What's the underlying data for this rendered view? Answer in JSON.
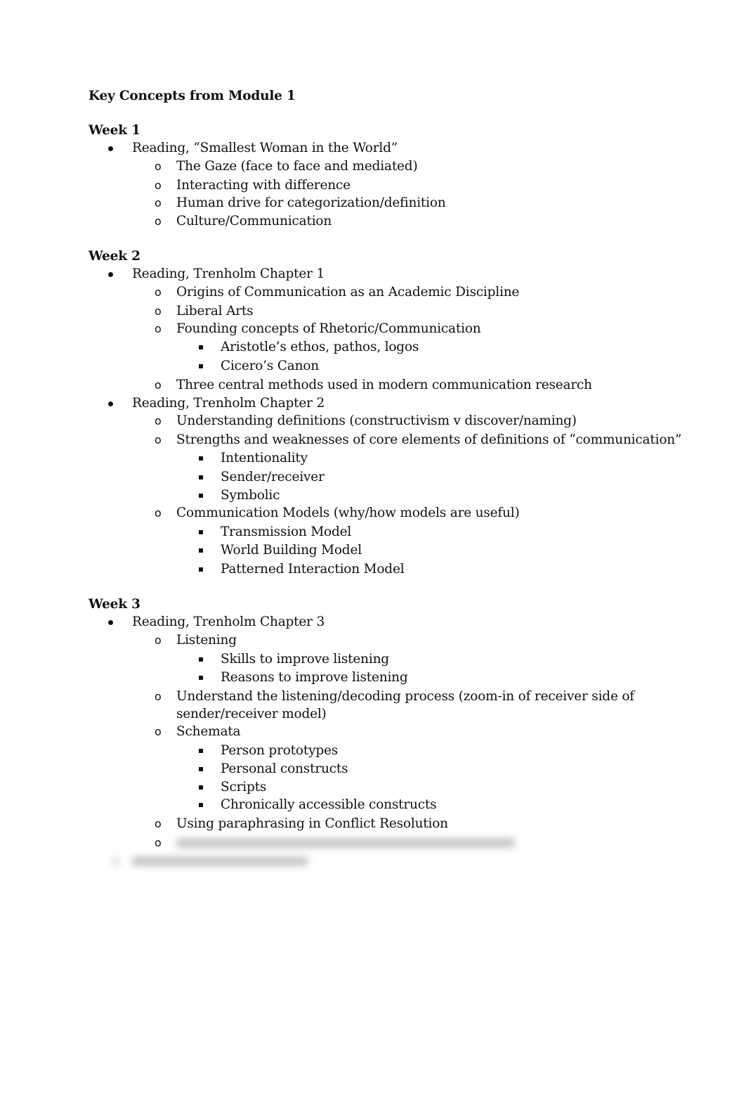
{
  "document": {
    "title": "Key Concepts from Module 1",
    "weeks": [
      {
        "heading": "Week 1",
        "readings": [
          {
            "label": "Reading, “Smallest Woman in the World”",
            "topics": [
              {
                "label": "The Gaze (face to face and mediated)"
              },
              {
                "label": "Interacting with difference"
              },
              {
                "label": "Human drive for categorization/definition"
              },
              {
                "label": "Culture/Communication"
              }
            ]
          }
        ]
      },
      {
        "heading": "Week 2",
        "readings": [
          {
            "label": "Reading, Trenholm Chapter 1",
            "topics": [
              {
                "label": "Origins of Communication as an Academic Discipline"
              },
              {
                "label": "Liberal Arts"
              },
              {
                "label": "Founding concepts of Rhetoric/Communication",
                "subtopics": [
                  "Aristotle’s ethos, pathos, logos",
                  "Cicero’s Canon"
                ]
              },
              {
                "label": "Three central methods used in modern communication research"
              }
            ]
          },
          {
            "label": "Reading, Trenholm Chapter 2",
            "topics": [
              {
                "label": "Understanding definitions (constructivism v discover/naming)"
              },
              {
                "label": "Strengths and weaknesses of core elements of definitions of “communication”",
                "subtopics": [
                  "Intentionality",
                  "Sender/receiver",
                  "Symbolic"
                ]
              },
              {
                "label": "Communication Models (why/how models are useful)",
                "subtopics": [
                  "Transmission Model",
                  "World Building Model",
                  "Patterned Interaction Model"
                ]
              }
            ]
          }
        ]
      },
      {
        "heading": "Week 3",
        "readings": [
          {
            "label": "Reading, Trenholm Chapter 3",
            "topics": [
              {
                "label": "Listening",
                "subtopics": [
                  "Skills to improve listening",
                  "Reasons to improve listening"
                ]
              },
              {
                "label_line1": "Understand the listening/decoding process (zoom-in of receiver side of",
                "label_line2": "sender/receiver model)"
              },
              {
                "label": "Schemata",
                "subtopics": [
                  "Person prototypes",
                  "Personal constructs",
                  "Scripts",
                  "Chronically accessible constructs"
                ]
              },
              {
                "label": "Using paraphrasing in Conflict Resolution"
              }
            ]
          }
        ]
      }
    ]
  }
}
